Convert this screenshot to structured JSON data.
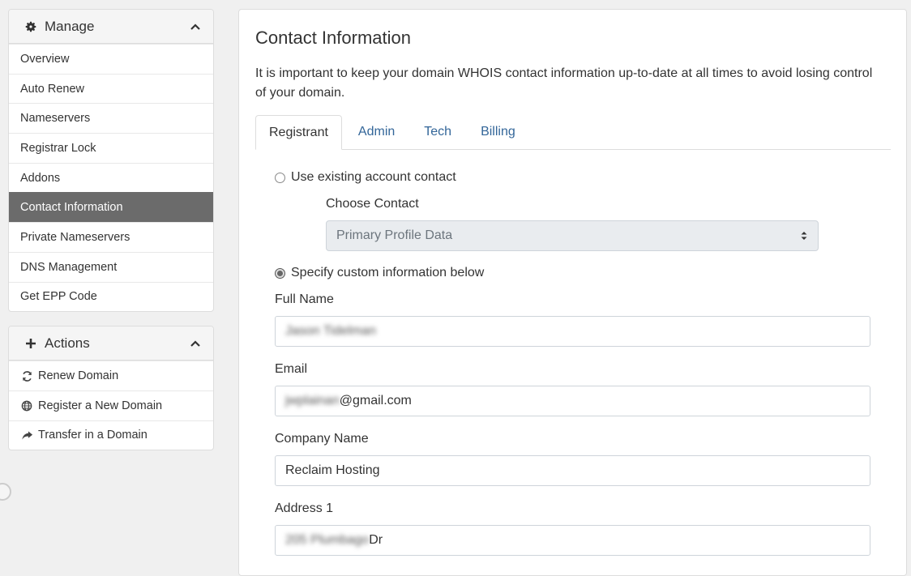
{
  "sidebar": {
    "manage": {
      "title": "Manage",
      "items": [
        {
          "label": "Overview"
        },
        {
          "label": "Auto Renew"
        },
        {
          "label": "Nameservers"
        },
        {
          "label": "Registrar Lock"
        },
        {
          "label": "Addons"
        },
        {
          "label": "Contact Information"
        },
        {
          "label": "Private Nameservers"
        },
        {
          "label": "DNS Management"
        },
        {
          "label": "Get EPP Code"
        }
      ]
    },
    "actions": {
      "title": "Actions",
      "items": [
        {
          "label": "Renew Domain",
          "icon": "refresh-icon"
        },
        {
          "label": "Register a New Domain",
          "icon": "globe-icon"
        },
        {
          "label": "Transfer in a Domain",
          "icon": "share-arrow-icon"
        }
      ]
    }
  },
  "main": {
    "title": "Contact Information",
    "intro": "It is important to keep your domain WHOIS contact information up-to-date at all times to avoid losing control of your domain.",
    "tabs": [
      {
        "label": "Registrant"
      },
      {
        "label": "Admin"
      },
      {
        "label": "Tech"
      },
      {
        "label": "Billing"
      }
    ],
    "use_existing_label": "Use existing account contact",
    "choose_contact_label": "Choose Contact",
    "choose_contact_value": "Primary Profile Data",
    "specify_custom_label": "Specify custom information below",
    "fields": {
      "full_name": {
        "label": "Full Name",
        "value": "Jason Tidelman"
      },
      "email": {
        "label": "Email",
        "value_hidden": "jwplainan",
        "value_visible": "@gmail.com"
      },
      "company": {
        "label": "Company Name",
        "value": "Reclaim Hosting"
      },
      "address1": {
        "label": "Address 1",
        "value_hidden": "205 Plumbago",
        "value_visible": " Dr"
      }
    }
  },
  "colors": {
    "active_nav": "#6b6b6b",
    "link": "#336699"
  }
}
